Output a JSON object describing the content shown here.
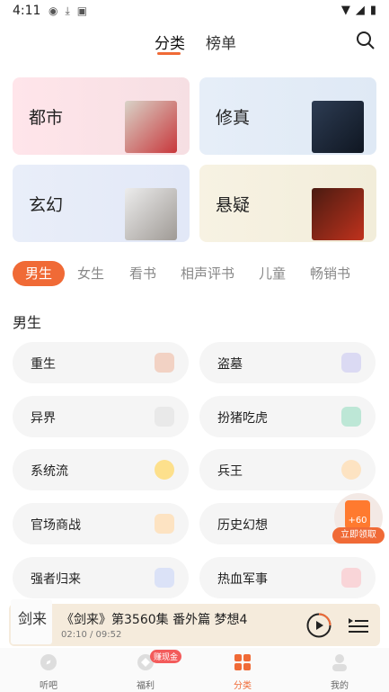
{
  "status_bar": {
    "time": "4:11",
    "left_icons": [
      "sim-icon",
      "download-icon",
      "a-icon"
    ],
    "right_icons": [
      "wifi-icon",
      "signal-icon",
      "battery-icon"
    ]
  },
  "top_nav": {
    "tabs": [
      {
        "label": "分类"
      },
      {
        "label": "榜单"
      }
    ],
    "active_tab": "分类",
    "search_icon": "search-icon"
  },
  "categories": [
    {
      "label": "都市",
      "cover_text": "开局",
      "color_from": "#ffe5ea",
      "color_to": "#f6dfe3"
    },
    {
      "label": "修真",
      "cover_text": "剑",
      "color_from": "#e6eef8",
      "color_to": "#dfe9f5"
    },
    {
      "label": "玄幻",
      "cover_text": "大",
      "color_from": "#e9eef9",
      "color_to": "#e2e8f7"
    },
    {
      "label": "悬疑",
      "cover_text": "恐",
      "color_from": "#f7f2e3",
      "color_to": "#f2edda"
    }
  ],
  "genre_tabs": [
    "男生",
    "女生",
    "看书",
    "相声评书",
    "儿童",
    "畅销书"
  ],
  "active_genre": "男生",
  "section_title": "男生",
  "items_left": [
    {
      "label": "重生",
      "icon_color": "#f2d2c4"
    },
    {
      "label": "异界",
      "icon_color": "#e9e9e9"
    },
    {
      "label": "系统流",
      "icon_color": "#fde08c"
    },
    {
      "label": "官场商战",
      "icon_color": "#fde3c2"
    },
    {
      "label": "强者归来",
      "icon_color": "#dbe2f7"
    }
  ],
  "items_right": [
    {
      "label": "盗墓",
      "icon_color": "#dbdaf3"
    },
    {
      "label": "扮猪吃虎",
      "icon_color": "#bde7d6"
    },
    {
      "label": "兵王",
      "icon_color": "#fde3c2"
    },
    {
      "label": "历史幻想",
      "icon_color": "#fde3c2"
    },
    {
      "label": "热血军事",
      "icon_color": "#f9d5d8"
    }
  ],
  "promo": {
    "amount": "+60",
    "button": "立即领取"
  },
  "player": {
    "title": "《剑来》第3560集 番外篇 梦想4",
    "time": "02:10 / 09:52",
    "thumb_text": "剑来"
  },
  "bottom_nav": {
    "items": [
      {
        "label": "听吧",
        "icon": "compass-icon"
      },
      {
        "label": "福利",
        "icon": "gift-icon"
      },
      {
        "label": "分类",
        "icon": "grid-icon"
      },
      {
        "label": "我的",
        "icon": "user-icon"
      }
    ],
    "active": "分类",
    "badge": "赚现金"
  },
  "colors": {
    "accent": "#f06a36"
  }
}
